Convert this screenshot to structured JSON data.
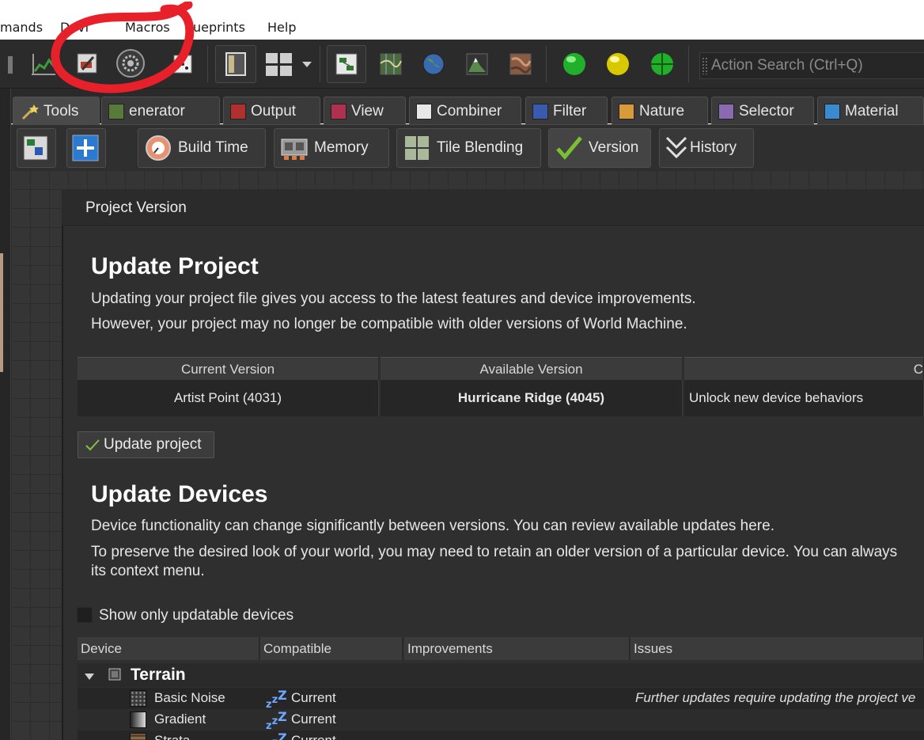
{
  "menu": {
    "items": [
      "mands",
      "Devi",
      "Macros",
      "ueprints",
      "Help"
    ]
  },
  "toolbar": {
    "search_placeholder": "Action Search (Ctrl+Q)"
  },
  "tabs": [
    {
      "label": "Tools",
      "icon": "wand-icon"
    },
    {
      "label": "Generator",
      "visible_label": "enerator",
      "icon": "generator-icon"
    },
    {
      "label": "Output",
      "icon": "output-icon"
    },
    {
      "label": "View",
      "icon": "view-icon"
    },
    {
      "label": "Combiner",
      "icon": "combiner-icon"
    },
    {
      "label": "Filter",
      "icon": "filter-icon"
    },
    {
      "label": "Nature",
      "icon": "nature-icon"
    },
    {
      "label": "Selector",
      "icon": "selector-icon"
    },
    {
      "label": "Material",
      "icon": "material-icon"
    }
  ],
  "subtoolbar": {
    "build_time": "Build Time",
    "memory": "Memory",
    "tile_blending": "Tile Blending",
    "version": "Version",
    "history": "History"
  },
  "dialog": {
    "title": "Project Version",
    "update_project": {
      "heading": "Update Project",
      "line1": "Updating your project file gives you access to the latest features and device improvements.",
      "line2": "However, your project may no longer be compatible with older versions of World Machine."
    },
    "version_table": {
      "headers": [
        "Current Version",
        "Available Version",
        "C"
      ],
      "current": "Artist Point (4031)",
      "available": "Hurricane Ridge (4045)",
      "changes": "Unlock new device behaviors"
    },
    "update_button": "Update project",
    "update_devices": {
      "heading": "Update Devices",
      "line1": "Device functionality can change significantly between versions. You can review available updates here.",
      "line2a": "To preserve the desired look of your world, you may need to retain an older version of a particular device. You can always",
      "line2b": "its context menu."
    },
    "show_only_updatable": "Show only updatable devices",
    "device_table": {
      "headers": [
        "Device",
        "Compatible",
        "Improvements",
        "Issues"
      ],
      "group": "Terrain",
      "rows": [
        {
          "name": "Basic Noise",
          "compatible": "Current",
          "issue": "Further updates require updating the project ve",
          "icon_color": "#3a3a3a"
        },
        {
          "name": "Gradient",
          "compatible": "Current",
          "issue": "",
          "icon_color": "#8a8a8a"
        },
        {
          "name": "Strata",
          "compatible": "Current",
          "issue": "",
          "icon_color": "#8b6a4a"
        }
      ]
    }
  },
  "annotation_color": "#e8202a"
}
